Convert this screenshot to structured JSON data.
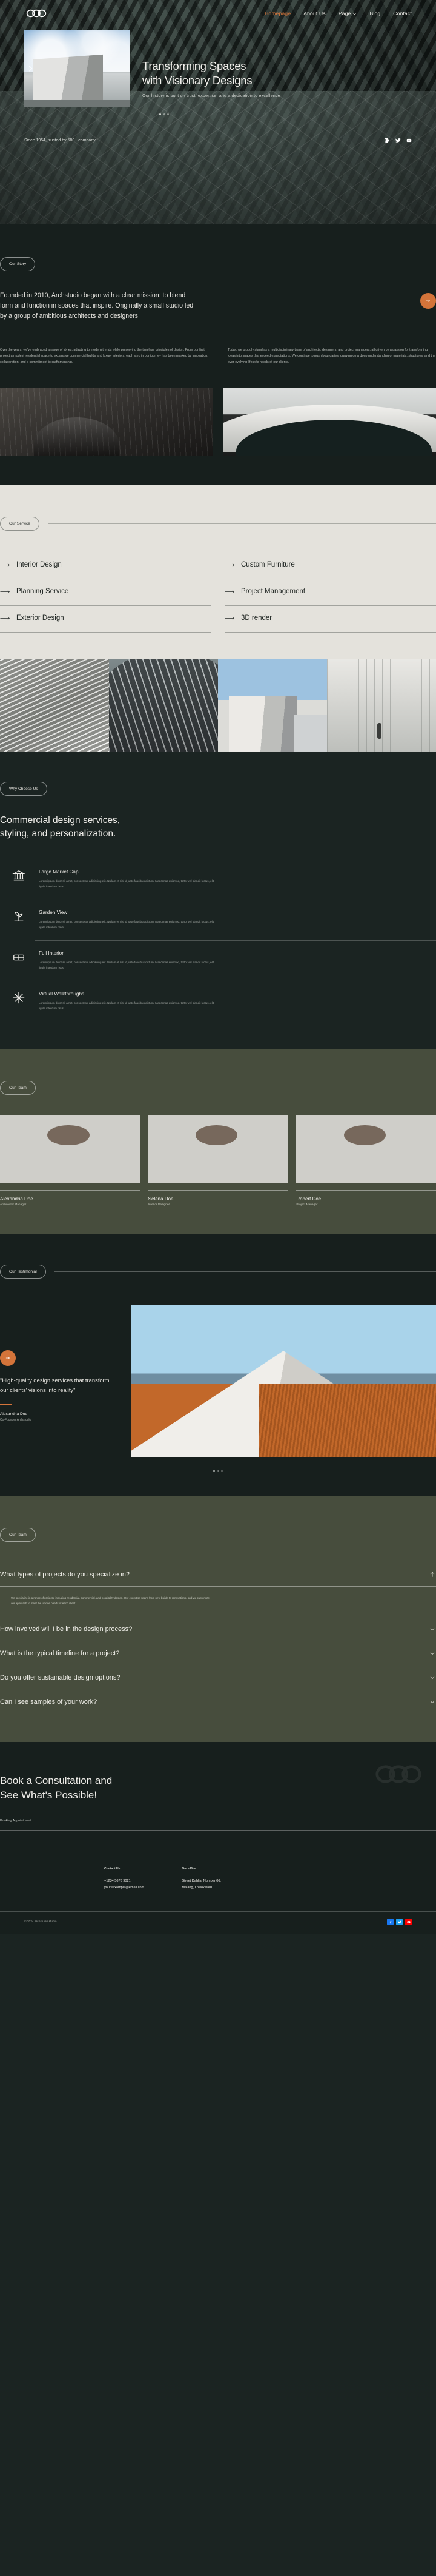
{
  "brand": {
    "logo_name": "archstudio-logo"
  },
  "nav": {
    "items": [
      {
        "label": "Homepage",
        "active": true
      },
      {
        "label": "About Us",
        "active": false
      },
      {
        "label": "Page",
        "active": false,
        "has_chevron": true
      },
      {
        "label": "Blog",
        "active": false
      },
      {
        "label": "Contact",
        "active": false
      }
    ]
  },
  "hero": {
    "title_line1": "Transforming Spaces",
    "title_line2": "with Visionary Designs",
    "subtitle": "Our history is built on trust, expertise, and a dedication to excellence",
    "since_text": "Since 1954, trusted by 500+ company",
    "socials": [
      "facebook-icon",
      "twitter-icon",
      "youtube-icon"
    ]
  },
  "story": {
    "pill": "Our Story",
    "lead": "Founded in 2010, Archstudio began with a clear mission: to blend form and function in spaces that inspire. Originally a small studio led by a group of ambitious architects and designers",
    "col_left": "Over the years, we've embraced a range of styles, adapting to modern trends while preserving the timeless principles of design. From our first project a modest residential space to expansive commercial builds and luxury interiors, each step in our journey has been marked by innovation, collaboration, and a commitment to craftsmanship.",
    "col_right": "Today, we proudly stand as a multidisciplinary team of architects, designers, and project managers, all driven by a passion for transforming ideas into spaces that exceed expectations. We continue to push boundaries, drawing on a deep understanding of materials, structures, and the ever-evolving lifestyle needs of our clients."
  },
  "services": {
    "pill": "Our Service",
    "items": [
      "Interior Design",
      "Custom Furniture",
      "Planning Service",
      "Project Management",
      "Exterior Design",
      "3D render"
    ]
  },
  "why": {
    "pill": "Why Choose Us",
    "heading_line1": "Commercial design services,",
    "heading_line2": "styling, and personalization.",
    "features": [
      {
        "icon": "bank-building-icon",
        "title": "Large Market Cap",
        "text": "Lorem ipsum dolor sit amet, consectetur adipiscing elit. Nullam et nisl id justo faucibus dictum. Maecenas euismod, tortor vel blandit luctus, elit ligula interdum risus"
      },
      {
        "icon": "plant-garden-icon",
        "title": "Garden View",
        "text": "Lorem ipsum dolor sit amet, consectetur adipiscing elit. Nullam et nisl id justo faucibus dictum. Maecenas euismod, tortor vel blandit luctus, elit ligula interdum risus"
      },
      {
        "icon": "bed-icon",
        "title": "Full Interior",
        "text": "Lorem ipsum dolor sit amet, consectetur adipiscing elit. Nullam et nisl id justo faucibus dictum. Maecenas euismod, tortor vel blandit luctus, elit ligula interdum risus"
      },
      {
        "icon": "snowflake-icon",
        "title": "Virtual Walkthroughs",
        "text": "Lorem ipsum dolor sit amet, consectetur adipiscing elit. Nullam et nisl id justo faucibus dictum. Maecenas euismod, tortor vel blandit luctus, elit ligula interdum risus"
      }
    ]
  },
  "team": {
    "pill": "Our Team",
    "members": [
      {
        "name": "Alexandria Doe",
        "role": "Architector Manager"
      },
      {
        "name": "Selena Doe",
        "role": "Interior Designer"
      },
      {
        "name": "Robert Doe",
        "role": "Project Manager"
      }
    ]
  },
  "testimonial": {
    "pill": "Our Testimonial",
    "quote": "\"High-quality design services that transform our clients' visions into reality\"",
    "author": "Alexandria Doe",
    "role": "Co-Founder Archstudio"
  },
  "faq": {
    "pill": "Our Team",
    "items": [
      {
        "question": "What types of projects do you specialize in?",
        "answer": "We specialize in a range of projects, including residential, commercial, and hospitality design. Our expertise spans from new builds to renovations, and we customize our approach to meet the unique needs of each client.",
        "open": true
      },
      {
        "question": "How involved will I be in the design process?",
        "answer": "",
        "open": false
      },
      {
        "question": "What is the typical timeline for a project?",
        "answer": "",
        "open": false
      },
      {
        "question": "Do you offer sustainable design options?",
        "answer": "",
        "open": false
      },
      {
        "question": "Can I see samples of your work?",
        "answer": "",
        "open": false
      }
    ]
  },
  "cta": {
    "heading_line1": "Book a Consultation and",
    "heading_line2": "See What's Possible!",
    "label": "Booking Appointment"
  },
  "footer": {
    "contact_heading": "Contact Us",
    "phone": "+1234 5678 9021",
    "email": "youreexample@email.com",
    "office_heading": "Our office",
    "address_line1": "Street Dahlia, Number 06,",
    "address_line2": "Malang, Lowokwaru",
    "copyright": "© 2024 Archstudio studio",
    "socials": [
      "facebook-icon",
      "twitter-icon",
      "youtube-icon"
    ]
  },
  "colors": {
    "accent": "#d4743a",
    "dark": "#171f1d",
    "olive": "#474d3d",
    "cream": "#e4e2dc"
  }
}
